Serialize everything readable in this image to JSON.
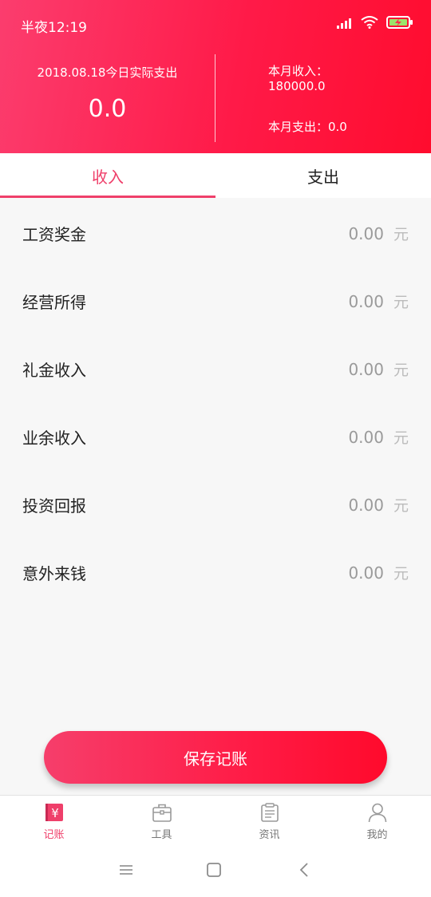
{
  "status_bar": {
    "time": "半夜12:19",
    "icons": [
      "signal-icon",
      "wifi-icon",
      "battery-charging-icon"
    ]
  },
  "summary": {
    "today_label": "2018.08.18今日实际支出",
    "today_value": "0.0",
    "month_income_label": "本月收入：",
    "month_income_value": "180000.0",
    "month_expense_text": "本月支出：0.0"
  },
  "tabs": [
    {
      "label": "收入",
      "active": true
    },
    {
      "label": "支出",
      "active": false
    }
  ],
  "income_rows": [
    {
      "label": "工资奖金",
      "value": "0.00",
      "unit": "元"
    },
    {
      "label": "经营所得",
      "value": "0.00",
      "unit": "元"
    },
    {
      "label": "礼金收入",
      "value": "0.00",
      "unit": "元"
    },
    {
      "label": "业余收入",
      "value": "0.00",
      "unit": "元"
    },
    {
      "label": "投资回报",
      "value": "0.00",
      "unit": "元"
    },
    {
      "label": "意外来钱",
      "value": "0.00",
      "unit": "元"
    }
  ],
  "save_button": "保存记账",
  "bottom_nav": [
    {
      "label": "记账",
      "icon": "ledger-yen-icon",
      "active": true
    },
    {
      "label": "工具",
      "icon": "toolbox-icon",
      "active": false
    },
    {
      "label": "资讯",
      "icon": "clipboard-icon",
      "active": false
    },
    {
      "label": "我的",
      "icon": "user-icon",
      "active": false
    }
  ],
  "colors": {
    "accent": "#ef3f6a",
    "header_start": "#fb3d6e",
    "header_end": "#ff0c2e"
  }
}
